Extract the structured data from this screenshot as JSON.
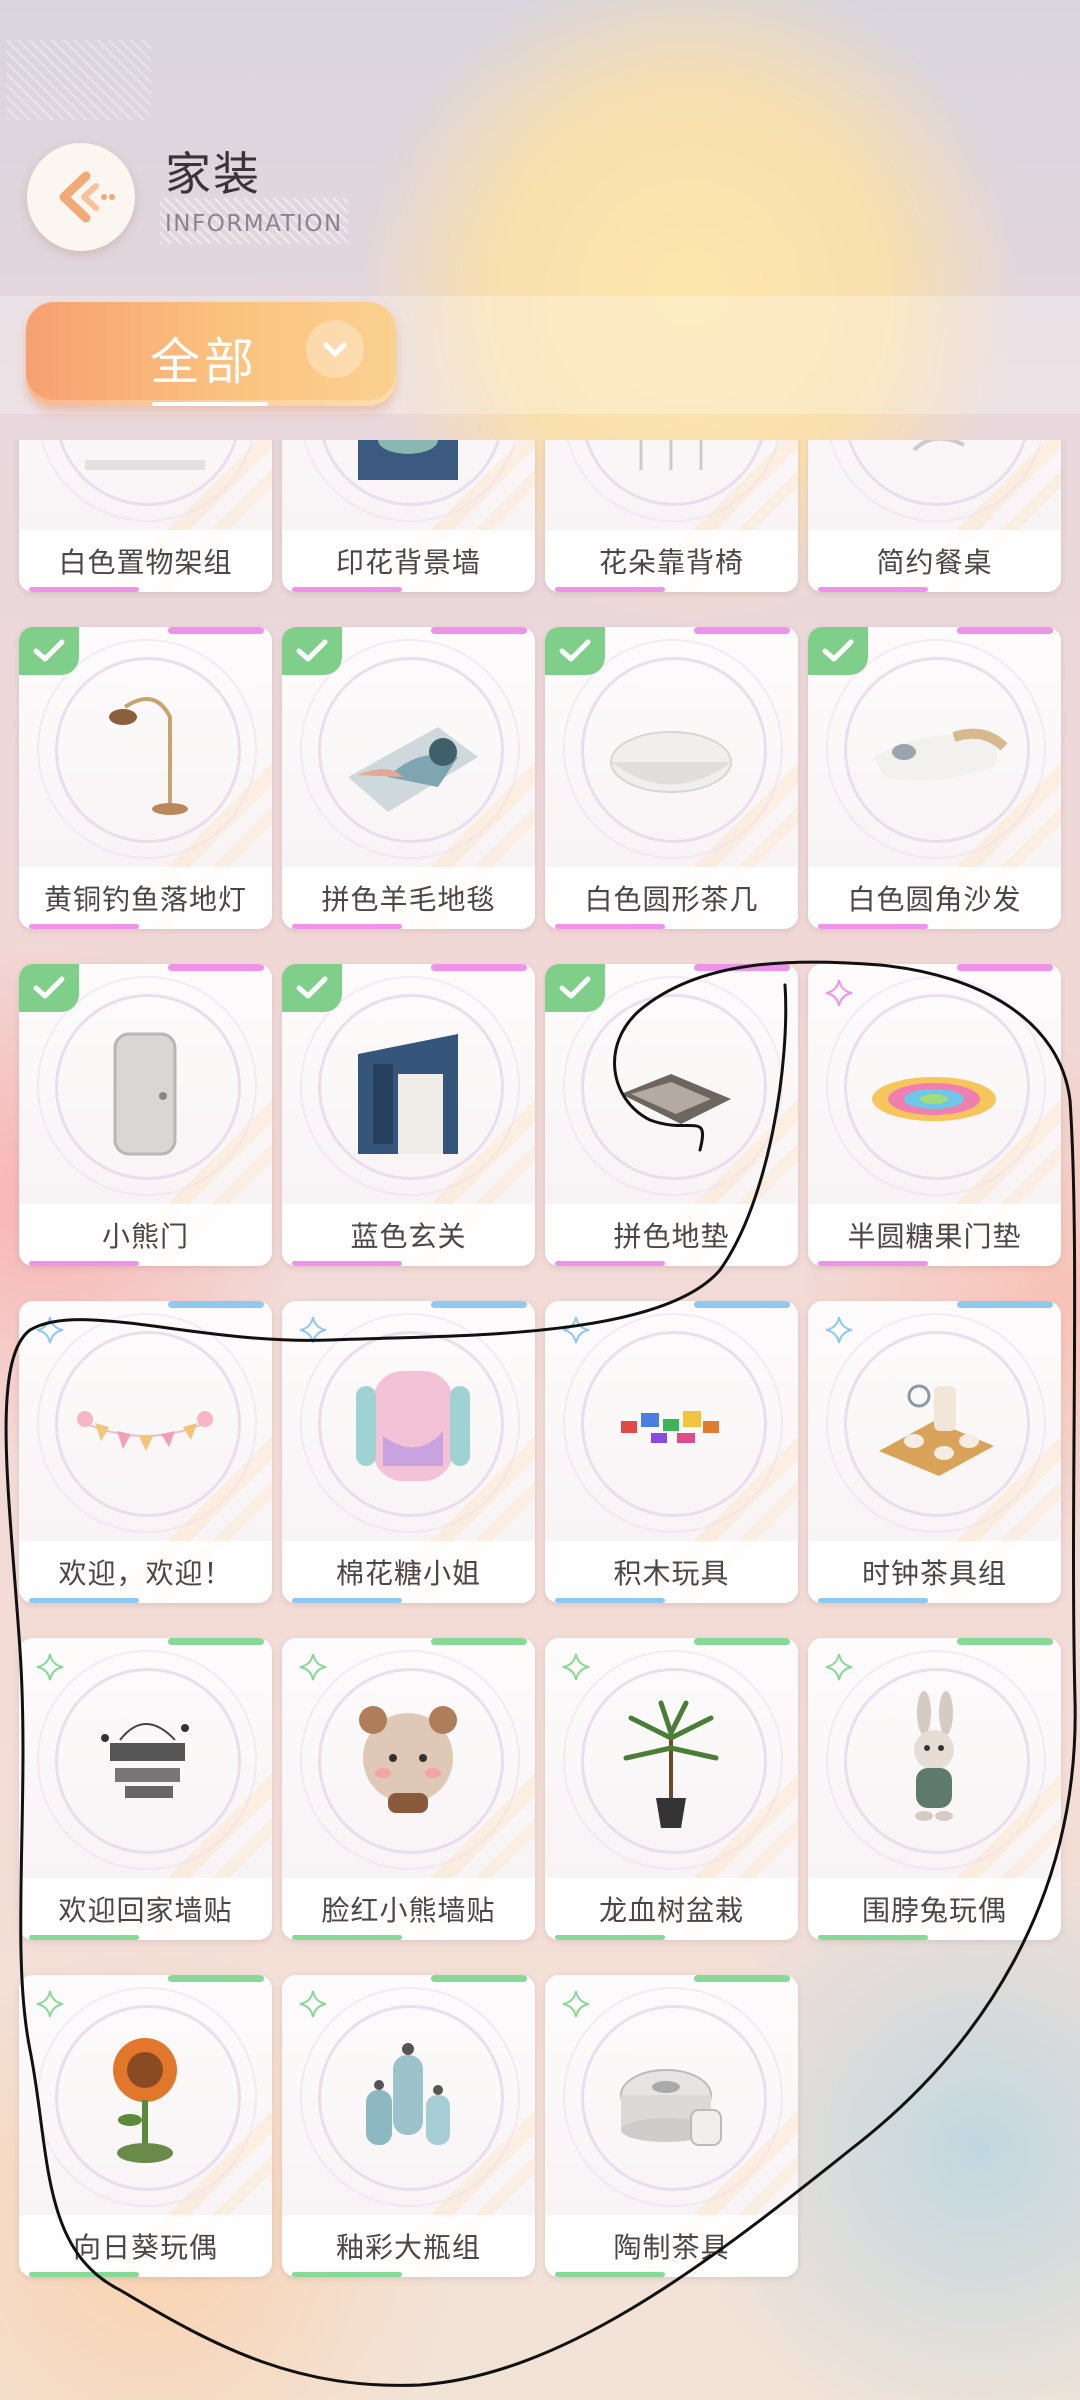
{
  "header": {
    "title": "家装",
    "subtitle": "INFORMATION",
    "back_icon": "back-arrow-icon"
  },
  "filter": {
    "label": "全部",
    "dropdown_icon": "chevron-down-icon"
  },
  "items": [
    {
      "name": "白色置物架组",
      "owned": false,
      "rarity": "pink",
      "icon": "shelf-icon"
    },
    {
      "name": "印花背景墙",
      "owned": false,
      "rarity": "pink",
      "icon": "wall-icon"
    },
    {
      "name": "花朵靠背椅",
      "owned": false,
      "rarity": "pink",
      "icon": "chair-icon"
    },
    {
      "name": "简约餐桌",
      "owned": false,
      "rarity": "pink",
      "icon": "table-icon"
    },
    {
      "name": "黄铜钓鱼落地灯",
      "owned": true,
      "rarity": "pink",
      "icon": "floor-lamp-icon"
    },
    {
      "name": "拼色羊毛地毯",
      "owned": true,
      "rarity": "pink",
      "icon": "rug-icon"
    },
    {
      "name": "白色圆形茶几",
      "owned": true,
      "rarity": "pink",
      "icon": "round-table-icon"
    },
    {
      "name": "白色圆角沙发",
      "owned": true,
      "rarity": "pink",
      "icon": "sofa-icon"
    },
    {
      "name": "小熊门",
      "owned": true,
      "rarity": "pink",
      "icon": "door-icon"
    },
    {
      "name": "蓝色玄关",
      "owned": true,
      "rarity": "pink",
      "icon": "entryway-icon"
    },
    {
      "name": "拼色地垫",
      "owned": true,
      "rarity": "pink",
      "icon": "floor-mat-icon"
    },
    {
      "name": "半圆糖果门垫",
      "owned": false,
      "rarity": "pink",
      "icon": "candy-mat-icon"
    },
    {
      "name": "欢迎，欢迎！",
      "owned": false,
      "rarity": "blue",
      "icon": "bunting-icon"
    },
    {
      "name": "棉花糖小姐",
      "owned": false,
      "rarity": "blue",
      "icon": "cushion-icon"
    },
    {
      "name": "积木玩具",
      "owned": false,
      "rarity": "blue",
      "icon": "blocks-icon"
    },
    {
      "name": "时钟茶具组",
      "owned": false,
      "rarity": "blue",
      "icon": "tea-set-icon"
    },
    {
      "name": "欢迎回家墙贴",
      "owned": false,
      "rarity": "green",
      "icon": "wall-sticker-icon"
    },
    {
      "name": "脸红小熊墙贴",
      "owned": false,
      "rarity": "green",
      "icon": "bear-sticker-icon"
    },
    {
      "name": "龙血树盆栽",
      "owned": false,
      "rarity": "green",
      "icon": "potted-plant-icon"
    },
    {
      "name": "围脖兔玩偶",
      "owned": false,
      "rarity": "green",
      "icon": "bunny-doll-icon"
    },
    {
      "name": "向日葵玩偶",
      "owned": false,
      "rarity": "green",
      "icon": "sunflower-doll-icon"
    },
    {
      "name": "釉彩大瓶组",
      "owned": false,
      "rarity": "green",
      "icon": "vase-set-icon"
    },
    {
      "name": "陶制茶具",
      "owned": false,
      "rarity": "green",
      "icon": "teapot-icon"
    }
  ],
  "colors": {
    "owned_check": "#7fcf8a",
    "pink_rarity": "#ee92ea",
    "blue_rarity": "#8fc8f0",
    "green_rarity": "#86d996",
    "filter_button": "#f7a070"
  }
}
